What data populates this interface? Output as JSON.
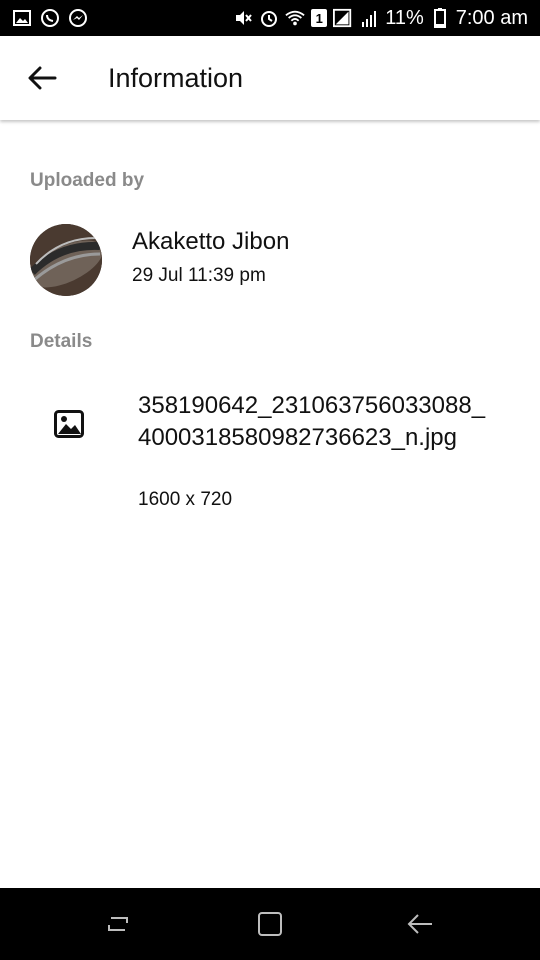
{
  "status_bar": {
    "battery_text": "11%",
    "time": "7:00 am",
    "sim_slot": "1",
    "icons_left": [
      "gallery-icon",
      "whatsapp-icon",
      "messenger-icon"
    ],
    "icons_right": [
      "mute-icon",
      "alarm-icon",
      "wifi-icon",
      "sim-icon",
      "signal-icon",
      "battery-icon"
    ]
  },
  "app_bar": {
    "title": "Information"
  },
  "uploaded_section": {
    "label": "Uploaded by",
    "uploader_name": "Akaketto Jibon",
    "timestamp": "29 Jul 11:39 pm"
  },
  "details_section": {
    "label": "Details",
    "file_name": "358190642_231063756033088_4000318580982736623_n.jpg",
    "dimensions": "1600 x 720"
  },
  "colors": {
    "status_bar_bg": "#000000",
    "section_label": "#8a8a8a",
    "text_primary": "#111111"
  }
}
